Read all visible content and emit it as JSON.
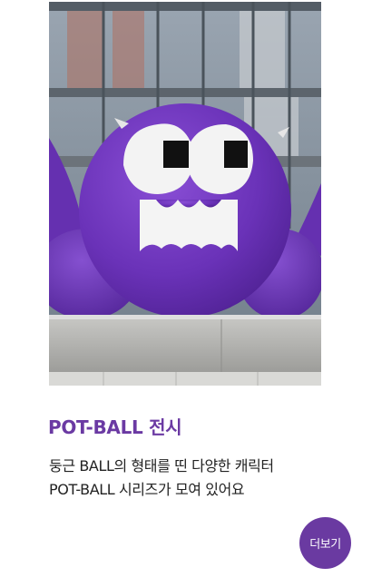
{
  "card": {
    "image_alt": "POT-BALL",
    "title": "POT-BALL 전시",
    "description_line1": "둥근 BALL의 형태를 띤 다양한 캐릭터",
    "description_line2": "POT-BALL 시리즈가 모여 있어요",
    "more_label": "더보기"
  },
  "colors": {
    "accent": "#6b3aa3",
    "button": "#6a3aa1",
    "text": "#222222"
  }
}
